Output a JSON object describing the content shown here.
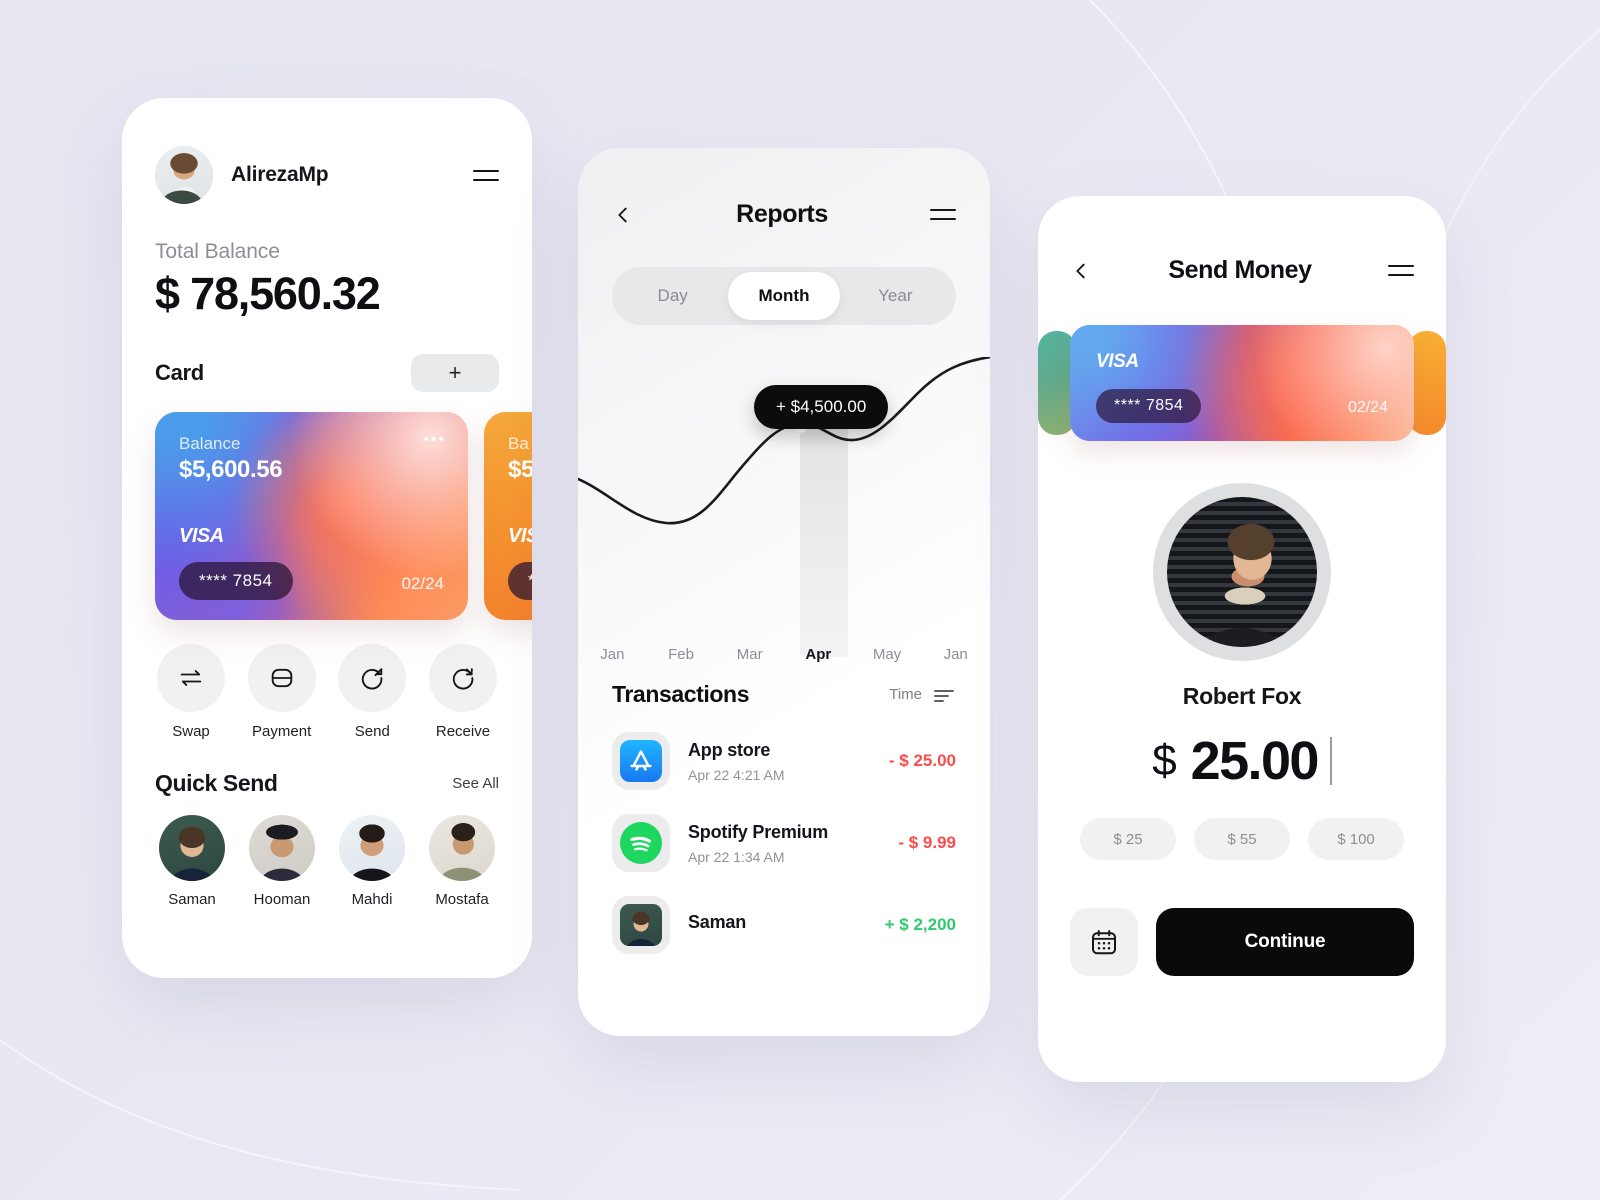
{
  "background": {
    "color": "#e7e6f1"
  },
  "screen_home": {
    "user": {
      "name": "AlirezaMp",
      "avatar": "user-avatar"
    },
    "menu_icon": "hamburger-icon",
    "total_balance_label": "Total Balance",
    "total_balance_value": "$ 78,560.32",
    "card_section_title": "Card",
    "add_card_label": "+",
    "cards": [
      {
        "balance_label": "Balance",
        "balance": "$5,600.56",
        "brand": "VISA",
        "number": "**** 7854",
        "expiry": "02/24",
        "more_icon": "more-dots-icon"
      },
      {
        "balance_label": "Ba",
        "balance": "$5",
        "brand": "VIS",
        "number": "*",
        "expiry": ""
      }
    ],
    "actions": [
      {
        "label": "Swap",
        "icon": "swap-arrows-icon"
      },
      {
        "label": "Payment",
        "icon": "card-icon"
      },
      {
        "label": "Send",
        "icon": "send-arrow-icon"
      },
      {
        "label": "Receive",
        "icon": "receive-arrow-icon"
      }
    ],
    "quick_send": {
      "title": "Quick Send",
      "see_all_label": "See All",
      "contacts": [
        {
          "name": "Saman"
        },
        {
          "name": "Hooman"
        },
        {
          "name": "Mahdi"
        },
        {
          "name": "Mostafa"
        }
      ]
    }
  },
  "screen_reports": {
    "back_icon": "chevron-left-icon",
    "title": "Reports",
    "menu_icon": "hamburger-icon",
    "range_tabs": [
      {
        "label": "Day",
        "active": false
      },
      {
        "label": "Month",
        "active": true
      },
      {
        "label": "Year",
        "active": false
      }
    ],
    "tooltip_value": "+ $4,500.00",
    "transactions_title": "Transactions",
    "sort_label": "Time",
    "sort_icon": "sort-lines-icon",
    "transactions": [
      {
        "name": "App store",
        "date": "Apr 22  4:21 AM",
        "amount": "- $ 25.00",
        "sign": "neg",
        "icon": "appstore-icon"
      },
      {
        "name": "Spotify Premium",
        "date": "Apr 22  1:34 AM",
        "amount": "- $ 9.99",
        "sign": "neg",
        "icon": "spotify-icon"
      },
      {
        "name": "Saman",
        "date": "",
        "amount": "+ $ 2,200",
        "sign": "pos",
        "icon": "contact-avatar-icon"
      }
    ]
  },
  "screen_send": {
    "back_icon": "chevron-left-icon",
    "title": "Send Money",
    "menu_icon": "hamburger-icon",
    "card": {
      "brand": "VISA",
      "number": "**** 7854",
      "expiry": "02/24"
    },
    "recipient_name": "Robert Fox",
    "amount_currency": "$",
    "amount_value": "25.00",
    "quick_amounts": [
      {
        "label": "$ 25"
      },
      {
        "label": "$ 55"
      },
      {
        "label": "$ 100"
      }
    ],
    "calendar_icon": "calendar-icon",
    "continue_label": "Continue"
  },
  "chart_data": {
    "type": "line",
    "title": "",
    "categories": [
      "Jan",
      "Feb",
      "Mar",
      "Apr",
      "May",
      "Jan"
    ],
    "values": [
      2900,
      1700,
      2100,
      4500,
      4100,
      5600
    ],
    "highlight_category": "Apr",
    "highlight_value": 4500,
    "highlight_label": "+ $4,500.00",
    "xlabel": "",
    "ylabel": "",
    "grid": false,
    "legend": "none",
    "line_color": "#1a1a1e",
    "point_color": "#ffffff"
  }
}
